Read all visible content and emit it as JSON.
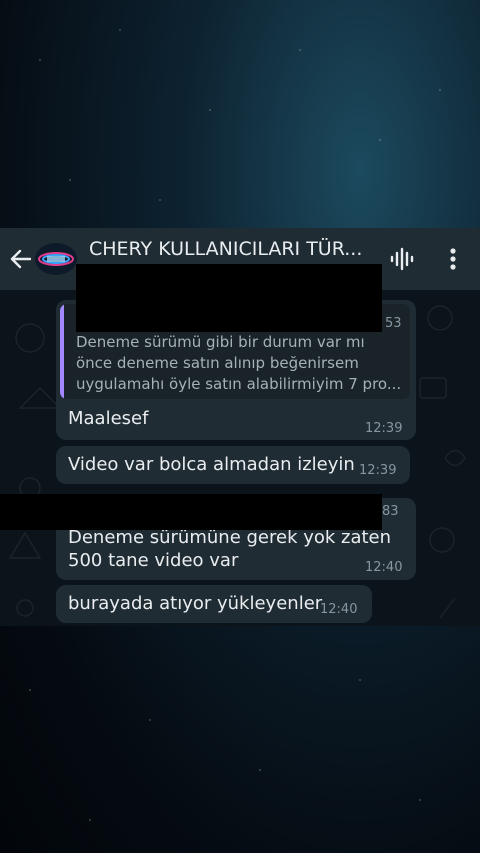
{
  "header": {
    "title": "CHERY KULLANICILARI TÜR...",
    "back_icon": "arrow-left-icon",
    "voice_icon": "voice-chat-icon",
    "menu_icon": "more-vertical-icon"
  },
  "messages": [
    {
      "reply_count": "53",
      "quote_lines": [
        "Deneme sürümü gibi bir durum var mı",
        "önce deneme satın alınıp beğenirsem",
        "uygulamahı öyle satın alabilirmiyim 7 pro..."
      ],
      "text": "Maalesef",
      "time": "12:39"
    },
    {
      "text": "Video var bolca almadan izleyin",
      "time": "12:39"
    },
    {
      "reply_count": "83",
      "lines": [
        "Deneme sürümüne gerek yok zaten",
        "500 tane video var"
      ],
      "time": "12:40"
    },
    {
      "text": "burayada atıyor yükleyenler",
      "time": "12:40"
    }
  ],
  "colors": {
    "header_bg": "#1f2c34",
    "bubble_bg": "#202c33",
    "chat_bg": "#0b141a",
    "quote_accent": "#a287ff",
    "text": "#e9edef",
    "meta": "#8696a0"
  }
}
